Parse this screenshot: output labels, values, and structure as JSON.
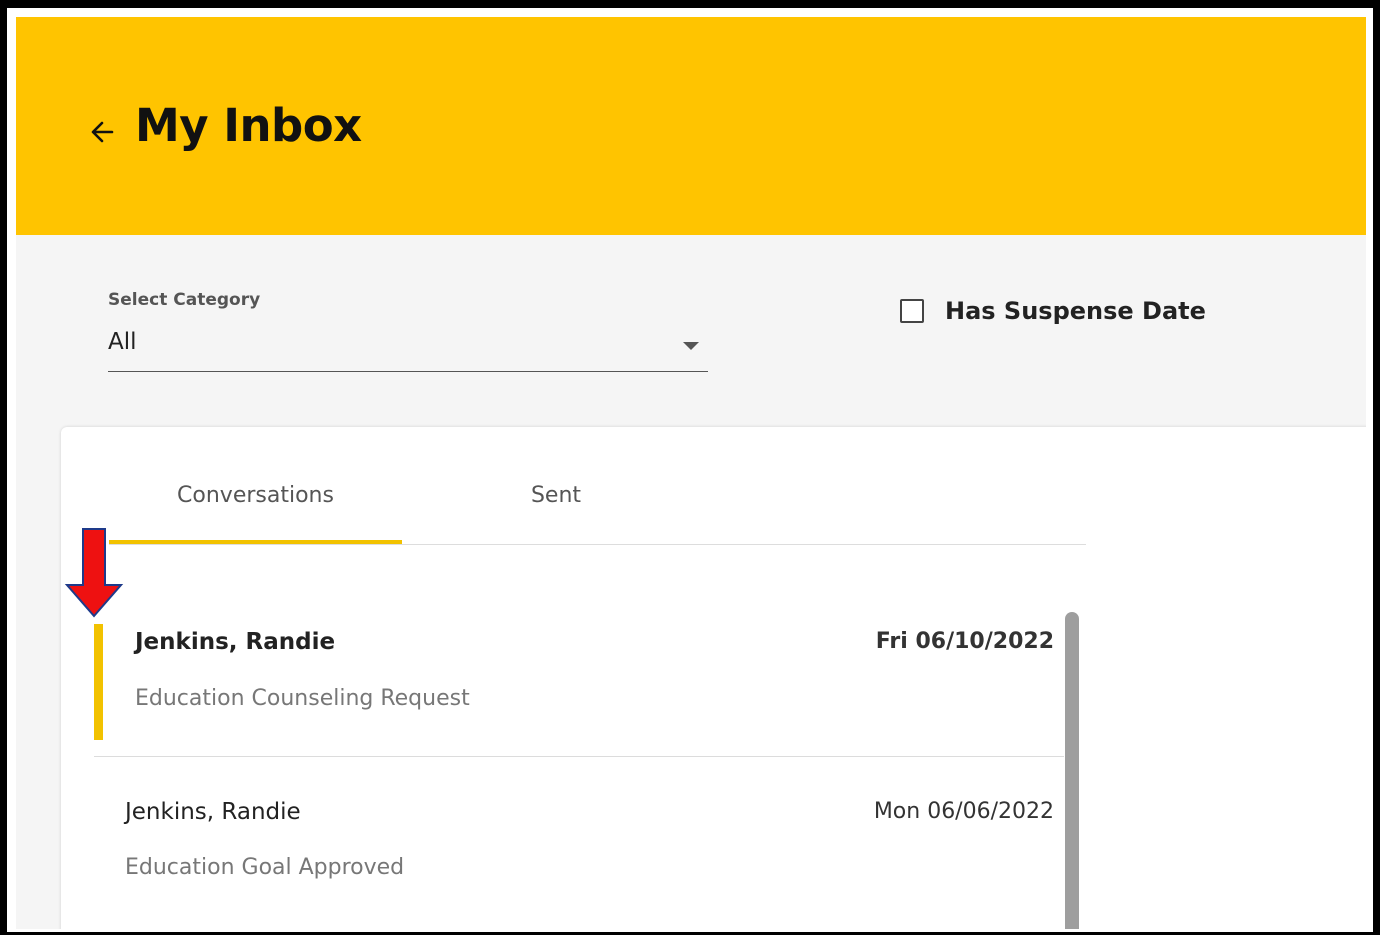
{
  "header": {
    "title": "My Inbox",
    "back_icon": "arrow-left-icon",
    "background_color": "#ffc400"
  },
  "filters": {
    "category": {
      "label": "Select Category",
      "value": "All",
      "icon": "caret-down-icon"
    },
    "suspense_checkbox": {
      "label": "Has Suspense Date",
      "checked": false
    }
  },
  "tabs": [
    {
      "label": "Conversations",
      "active": true
    },
    {
      "label": "Sent",
      "active": false
    }
  ],
  "messages": [
    {
      "name": "Jenkins, Randie",
      "subject": "Education Counseling Request",
      "date": "Fri 06/10/2022",
      "unread": true,
      "selected": true
    },
    {
      "name": "Jenkins, Randie",
      "subject": "Education Goal Approved",
      "date": "Mon 06/06/2022",
      "unread": false,
      "selected": false
    }
  ],
  "colors": {
    "accent": "#f2c200",
    "annotation_arrow": "#ee1111"
  }
}
